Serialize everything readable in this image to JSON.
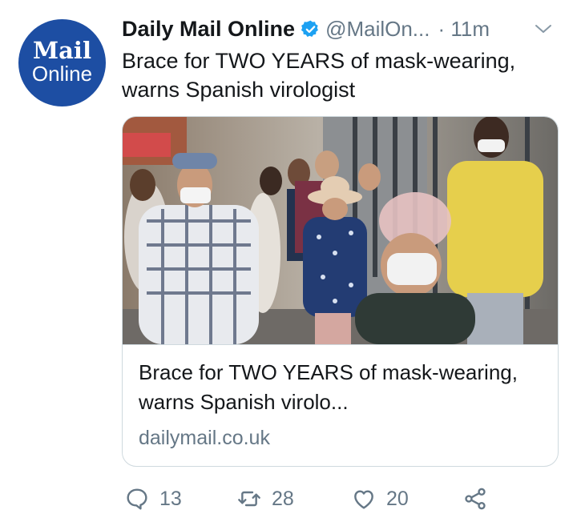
{
  "account": {
    "avatar_line1": "Mail",
    "avatar_line2": "Online",
    "name": "Daily Mail Online",
    "handle": "@MailOn...",
    "time": "· 11m"
  },
  "tweet": {
    "text": "Brace for TWO YEARS of mask-wearing, warns Spanish virologist"
  },
  "card": {
    "title": "Brace for TWO YEARS of mask-wearing, warns Spanish virolo...",
    "domain": "dailymail.co.uk"
  },
  "actions": {
    "replies": "13",
    "retweets": "28",
    "likes": "20"
  },
  "colors": {
    "avatar_bg": "#1d4ea3",
    "verified": "#1da1f2",
    "muted": "#657786"
  },
  "icons": [
    "verified-badge-icon",
    "chevron-down-icon",
    "reply-icon",
    "retweet-icon",
    "like-icon",
    "share-icon"
  ]
}
